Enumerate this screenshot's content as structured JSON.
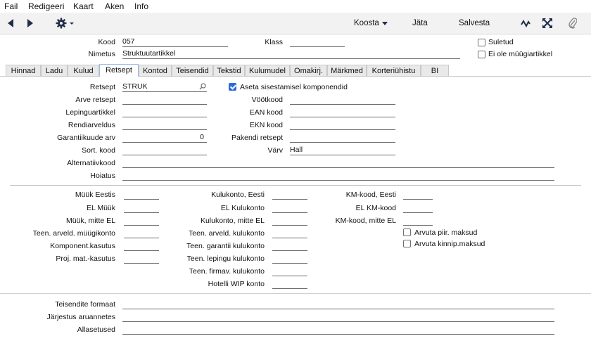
{
  "menu": [
    "Fail",
    "Redigeeri",
    "Kaart",
    "Aken",
    "Info"
  ],
  "toolbar": {
    "koosta": "Koosta",
    "jata": "Jäta",
    "salvesta": "Salvesta"
  },
  "header": {
    "kood_label": "Kood",
    "kood_value": "057",
    "nimetus_label": "Nimetus",
    "nimetus_value": "Struktuutartikkel",
    "klass_label": "Klass",
    "klass_value": "",
    "suletud": "Suletud",
    "ei_ole": "Ei ole müügiartikkel"
  },
  "tabs": [
    "Hinnad",
    "Ladu",
    "Kulud",
    "Retsept",
    "Kontod",
    "Teisendid",
    "Tekstid",
    "Kulumudel",
    "Omakirj.",
    "Märkmed",
    "Korteriühistu",
    "BI"
  ],
  "recipe": {
    "retsept_label": "Retsept",
    "retsept_value": "STRUK",
    "arve_retsept": "Arve retsept",
    "lepinguartikkel": "Lepinguartikkel",
    "rendiarveldus": "Rendiarveldus",
    "garantii_label": "Garantiikuude arv",
    "garantii_value": "0",
    "sort_kood": "Sort. kood",
    "alternatiivkood": "Alternatiivkood",
    "hoiatus": "Hoiatus",
    "aseta": "Aseta sisestamisel komponendid",
    "vootkood": "Vöötkood",
    "ean_kood": "EAN kood",
    "ekn_kood": "EKN kood",
    "pakendi_retsept": "Pakendi retsept",
    "varv_label": "Värv",
    "varv_value": "Hall"
  },
  "accounts": {
    "col1": [
      "Müük Eestis",
      "EL Müük",
      "Müük, mitte EL",
      "Teen. arveld. müügikonto",
      "Komponent.kasutus",
      "Proj. mat.-kasutus"
    ],
    "col2": [
      "Kulukonto, Eesti",
      "EL Kulukonto",
      "Kulukonto, mitte EL",
      "Teen. arveld. kulukonto",
      "Teen. garantii kulukonto",
      "Teen. lepingu kulukonto",
      "Teen. firmav. kulukonto",
      "Hotelli WIP konto"
    ],
    "col3": [
      "KM-kood, Eesti",
      "EL  KM-kood",
      "KM-kood, mitte EL"
    ],
    "arvuta_piir": "Arvuta piir. maksud",
    "arvuta_kinnip": "Arvuta kinnip.maksud"
  },
  "bottom": {
    "teisendite": "Teisendite formaat",
    "jarjestus": "Järjestus aruannetes",
    "allasetused": "Allasetused"
  },
  "colors": {
    "accent": "#2f6ad9",
    "toolbar_bg": "#f2f2f2"
  }
}
